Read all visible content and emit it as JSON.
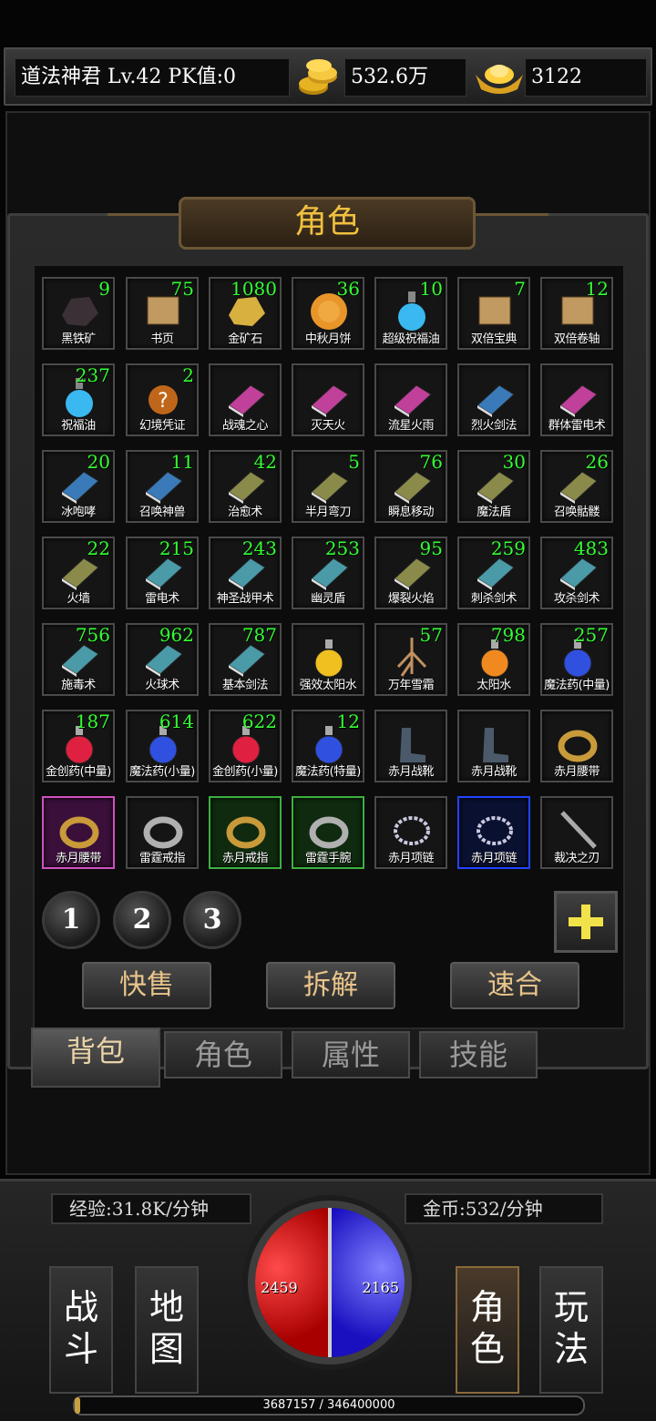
{
  "header": {
    "player": "道法神君  Lv.42 PK值:0",
    "gold": "532.6万",
    "ingot": "3122",
    "gold_icon": "gold-coins-icon",
    "ingot_icon": "gold-ingot-icon"
  },
  "panel": {
    "title": "角色"
  },
  "items": [
    {
      "name": "黑铁矿",
      "count": "9",
      "icon": "black-iron-ore-icon",
      "border": "normal"
    },
    {
      "name": "书页",
      "count": "75",
      "icon": "book-page-icon",
      "border": "normal"
    },
    {
      "name": "金矿石",
      "count": "1080",
      "icon": "gold-ore-icon",
      "border": "normal"
    },
    {
      "name": "中秋月饼",
      "count": "36",
      "icon": "mooncake-icon",
      "border": "normal"
    },
    {
      "name": "超级祝福油",
      "count": "10",
      "icon": "blessing-oil-flask-icon",
      "border": "normal"
    },
    {
      "name": "双倍宝典",
      "count": "7",
      "icon": "double-book-icon",
      "border": "normal"
    },
    {
      "name": "双倍卷轴",
      "count": "12",
      "icon": "scroll-icon",
      "border": "normal"
    },
    {
      "name": "祝福油",
      "count": "237",
      "icon": "blessing-oil-icon",
      "border": "normal"
    },
    {
      "name": "幻境凭证",
      "count": "2",
      "icon": "question-token-icon",
      "border": "normal"
    },
    {
      "name": "战魂之心",
      "count": "",
      "icon": "pink-skill-book-icon",
      "border": "normal"
    },
    {
      "name": "灭天火",
      "count": "",
      "icon": "pink-skill-book-icon",
      "border": "normal"
    },
    {
      "name": "流星火雨",
      "count": "",
      "icon": "pink-skill-book-icon",
      "border": "normal"
    },
    {
      "name": "烈火剑法",
      "count": "",
      "icon": "blue-skill-book-icon",
      "border": "normal"
    },
    {
      "name": "群体雷电术",
      "count": "",
      "icon": "pink-skill-book-icon",
      "border": "normal"
    },
    {
      "name": "冰咆哮",
      "count": "20",
      "icon": "blue-skill-book-icon",
      "border": "normal"
    },
    {
      "name": "召唤神兽",
      "count": "11",
      "icon": "blue-skill-book-icon",
      "border": "normal"
    },
    {
      "name": "治愈术",
      "count": "42",
      "icon": "olive-skill-book-icon",
      "border": "normal"
    },
    {
      "name": "半月弯刀",
      "count": "5",
      "icon": "olive-skill-book-icon",
      "border": "normal"
    },
    {
      "name": "瞬息移动",
      "count": "76",
      "icon": "olive-skill-book-icon",
      "border": "normal"
    },
    {
      "name": "魔法盾",
      "count": "30",
      "icon": "olive-skill-book-icon",
      "border": "normal"
    },
    {
      "name": "召唤骷髅",
      "count": "26",
      "icon": "olive-skill-book-icon",
      "border": "normal"
    },
    {
      "name": "火墙",
      "count": "22",
      "icon": "olive-skill-book-icon",
      "border": "normal"
    },
    {
      "name": "雷电术",
      "count": "215",
      "icon": "teal-skill-book-icon",
      "border": "normal"
    },
    {
      "name": "神圣战甲术",
      "count": "243",
      "icon": "teal-skill-book-icon",
      "border": "normal"
    },
    {
      "name": "幽灵盾",
      "count": "253",
      "icon": "teal-skill-book-icon",
      "border": "normal"
    },
    {
      "name": "爆裂火焰",
      "count": "95",
      "icon": "olive-skill-book-icon",
      "border": "normal"
    },
    {
      "name": "刺杀剑术",
      "count": "259",
      "icon": "teal-skill-book-icon",
      "border": "normal"
    },
    {
      "name": "攻杀剑术",
      "count": "483",
      "icon": "teal-skill-book-icon",
      "border": "normal"
    },
    {
      "name": "施毒术",
      "count": "756",
      "icon": "teal-skill-book-icon",
      "border": "normal"
    },
    {
      "name": "火球术",
      "count": "962",
      "icon": "teal-skill-book-icon",
      "border": "normal"
    },
    {
      "name": "基本剑法",
      "count": "787",
      "icon": "teal-skill-book-icon",
      "border": "normal"
    },
    {
      "name": "强效太阳水",
      "count": "",
      "icon": "yellow-potion-icon",
      "border": "normal"
    },
    {
      "name": "万年雪霜",
      "count": "57",
      "icon": "root-herb-icon",
      "border": "normal"
    },
    {
      "name": "太阳水",
      "count": "798",
      "icon": "orange-potion-icon",
      "border": "normal"
    },
    {
      "name": "魔法药(中量)",
      "count": "257",
      "icon": "blue-potion-icon",
      "border": "normal"
    },
    {
      "name": "金创药(中量)",
      "count": "187",
      "icon": "red-potion-icon",
      "border": "normal"
    },
    {
      "name": "魔法药(小量)",
      "count": "614",
      "icon": "blue-potion-icon",
      "border": "normal"
    },
    {
      "name": "金创药(小量)",
      "count": "622",
      "icon": "red-potion-icon",
      "border": "normal"
    },
    {
      "name": "魔法药(特量)",
      "count": "12",
      "icon": "blue-potion-large-icon",
      "border": "normal"
    },
    {
      "name": "赤月战靴",
      "count": "",
      "icon": "boots-icon",
      "border": "normal"
    },
    {
      "name": "赤月战靴",
      "count": "",
      "icon": "boots-icon",
      "border": "normal"
    },
    {
      "name": "赤月腰带",
      "count": "",
      "icon": "belt-icon",
      "border": "normal"
    },
    {
      "name": "赤月腰带",
      "count": "",
      "icon": "belt-icon",
      "border": "pink"
    },
    {
      "name": "雷霆戒指",
      "count": "",
      "icon": "silver-ring-icon",
      "border": "normal"
    },
    {
      "name": "赤月戒指",
      "count": "",
      "icon": "gold-ring-icon",
      "border": "green"
    },
    {
      "name": "雷霆手腕",
      "count": "",
      "icon": "bracelet-icon",
      "border": "green"
    },
    {
      "name": "赤月项链",
      "count": "",
      "icon": "necklace-icon",
      "border": "normal"
    },
    {
      "name": "赤月项链",
      "count": "",
      "icon": "necklace-icon",
      "border": "blue"
    },
    {
      "name": "裁决之刃",
      "count": "",
      "icon": "sword-icon",
      "border": "normal"
    }
  ],
  "pages": [
    "1",
    "2",
    "3"
  ],
  "actions": {
    "sell": "快售",
    "decompose": "拆解",
    "merge": "速合"
  },
  "tabs": [
    {
      "label": "背包",
      "active": true
    },
    {
      "label": "角色",
      "active": false
    },
    {
      "label": "属性",
      "active": false
    },
    {
      "label": "技能",
      "active": false
    }
  ],
  "hud": {
    "exp_rate": "经验:31.8K/分钟",
    "gold_rate": "金币:532/分钟",
    "hp": "2459",
    "mp": "2165",
    "exp_text": "3687157 / 346400000",
    "exp_progress": 0.0106,
    "left_buttons": [
      "战\n斗",
      "地\n图"
    ],
    "right_buttons": [
      "角\n色",
      "玩\n法"
    ]
  },
  "colors": {
    "count_green": "#33ff33",
    "title_gold": "#f0c040",
    "rare_pink": "#d050c0",
    "rare_green": "#3cb040",
    "rare_blue": "#2244ff",
    "hp_red": "#d01818",
    "mp_blue": "#3a2ae0"
  }
}
